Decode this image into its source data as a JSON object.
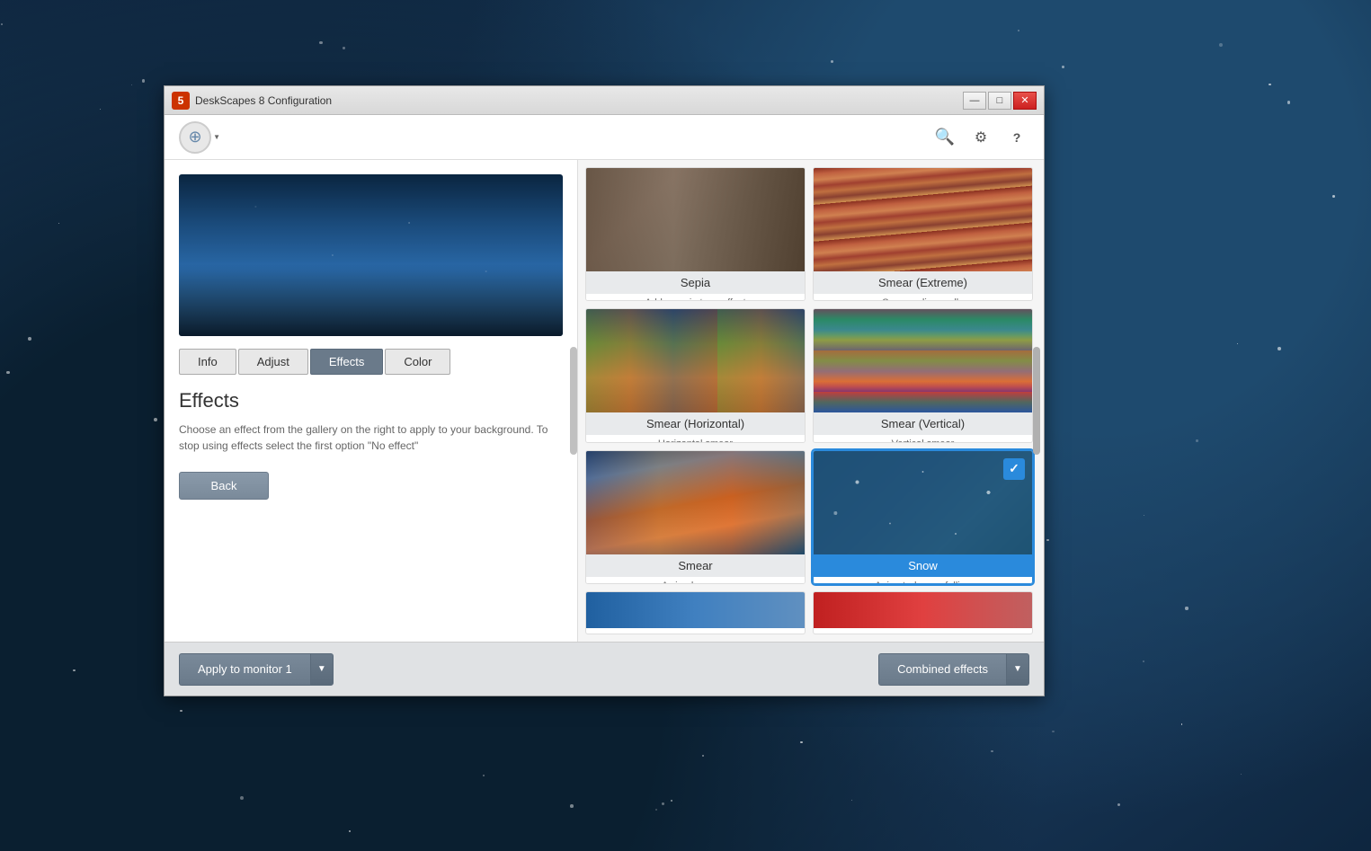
{
  "window": {
    "title": "DeskScapes 8 Configuration",
    "icon_label": "5"
  },
  "titlebar_controls": {
    "minimize": "—",
    "maximize": "□",
    "close": "✕"
  },
  "header": {
    "search_icon": "search-icon",
    "gear_icon": "gear-icon",
    "help_icon": "help-icon"
  },
  "tabs": [
    {
      "id": "info",
      "label": "Info",
      "active": false
    },
    {
      "id": "adjust",
      "label": "Adjust",
      "active": false
    },
    {
      "id": "effects",
      "label": "Effects",
      "active": true
    },
    {
      "id": "color",
      "label": "Color",
      "active": false
    }
  ],
  "left_panel": {
    "section_title": "Effects",
    "section_desc": "Choose an effect from the gallery on the right to apply to your background.  To stop using effects select the first option \"No effect\"",
    "back_button": "Back"
  },
  "effects": [
    {
      "id": "sepia",
      "label": "Sepia",
      "desc": "Add a sepia tone effect",
      "thumb_class": "thumb-sepia",
      "selected": false
    },
    {
      "id": "smear-extreme",
      "label": "Smear (Extreme)",
      "desc": "Smears diagonally",
      "thumb_class": "thumb-smear-extreme",
      "selected": false
    },
    {
      "id": "smear-horizontal",
      "label": "Smear (Horizontal)",
      "desc": "Horizontal smear",
      "thumb_class": "thumb-smear-horiz",
      "selected": false
    },
    {
      "id": "smear-vertical",
      "label": "Smear (Vertical)",
      "desc": "Vertical smear",
      "thumb_class": "thumb-smear-vert",
      "selected": false
    },
    {
      "id": "smear",
      "label": "Smear",
      "desc": "A simple smear",
      "thumb_class": "thumb-smear",
      "selected": false
    },
    {
      "id": "snow",
      "label": "Snow",
      "desc": "Animated snow falling",
      "thumb_class": "thumb-snow",
      "selected": true
    }
  ],
  "bottom_bar": {
    "apply_label": "Apply to monitor 1",
    "apply_dropdown_icon": "▼",
    "combined_label": "Combined effects",
    "combined_dropdown_icon": "▼"
  }
}
